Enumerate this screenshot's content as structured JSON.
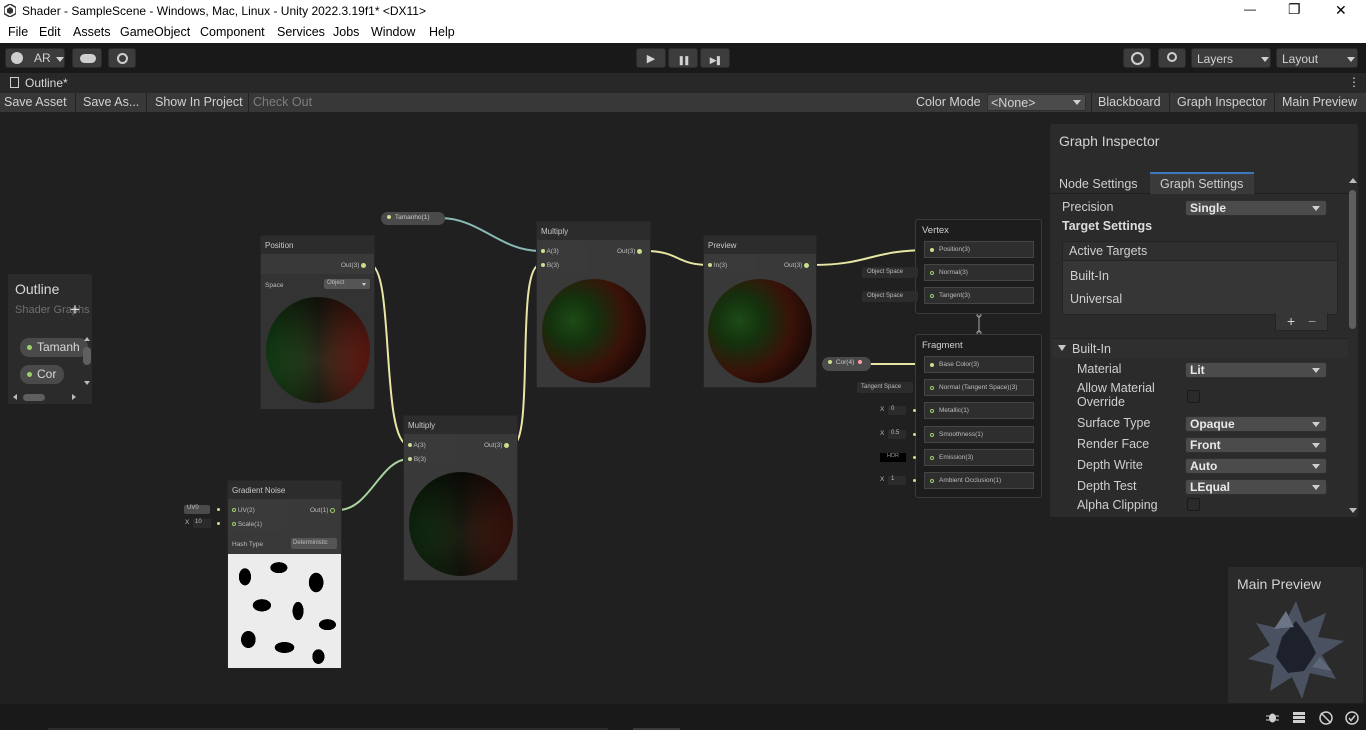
{
  "window": {
    "title": "Shader - SampleScene - Windows, Mac, Linux - Unity 2022.3.19f1* <DX11>",
    "minimize": "—",
    "restore": "❐",
    "close": "✕"
  },
  "menu": [
    "File",
    "Edit",
    "Assets",
    "GameObject",
    "Component",
    "Services",
    "Jobs",
    "Window",
    "Help"
  ],
  "toolbar": {
    "account_label": "AR",
    "play": "▶",
    "pause": "❚❚",
    "step": "▶❚",
    "layers_label": "Layers",
    "layout_label": "Layout"
  },
  "tab": {
    "label": "Outline*",
    "more": "⋮"
  },
  "graph_toolbar": {
    "save_asset": "Save Asset",
    "save_as": "Save As...",
    "show_in_project": "Show In Project",
    "check_out": "Check Out",
    "color_mode_label": "Color Mode",
    "color_mode_value": "<None>",
    "blackboard": "Blackboard",
    "graph_inspector": "Graph Inspector",
    "main_preview": "Main Preview"
  },
  "blackboard": {
    "title": "Outline",
    "subtitle": "Shader Graphs",
    "add": "+",
    "properties": [
      "Tamanh",
      "Cor"
    ]
  },
  "nodes": {
    "position": {
      "title": "Position",
      "out": "Out(3)",
      "space_label": "Space",
      "space_value": "Object"
    },
    "tamanho_pill": "Tamanho(1)",
    "multiply1": {
      "title": "Multiply",
      "a": "A(3)",
      "b": "B(3)",
      "out": "Out(3)"
    },
    "preview": {
      "title": "Preview",
      "in": "In(3)",
      "out": "Out(3)"
    },
    "multiply2": {
      "title": "Multiply",
      "a": "A(3)",
      "b": "B(3)",
      "out": "Out(3)"
    },
    "gradient_noise": {
      "title": "Gradient Noise",
      "uv": "UV(2)",
      "scale": "Scale(1)",
      "out": "Out(1)",
      "hash_label": "Hash Type",
      "hash_value": "Deterministic",
      "uv_ctx": "UV0",
      "scale_ctx_x": "X",
      "scale_ctx_val": "10"
    },
    "vertex": {
      "title": "Vertex",
      "position": "Position(3)",
      "normal": "Normal(3)",
      "tangent": "Tangent(3)",
      "normal_ctx": "Object Space",
      "tangent_ctx": "Object Space"
    },
    "fragment": {
      "title": "Fragment",
      "base_color": "Base Color(3)",
      "normal": "Normal (Tangent Space)(3)",
      "metallic": "Metallic(1)",
      "smoothness": "Smoothness(1)",
      "emission": "Emission(3)",
      "ao": "Ambient Occlusion(1)",
      "normal_ctx": "Tangent Space",
      "metallic_ctx_x": "X",
      "metallic_ctx_val": "0",
      "smoothness_ctx_x": "X",
      "smoothness_ctx_val": "0.5",
      "emission_ctx": "HDR",
      "ao_ctx_x": "X",
      "ao_ctx_val": "1"
    },
    "cor_pill": "Cor(4)"
  },
  "inspector": {
    "title": "Graph Inspector",
    "tab_node": "Node Settings",
    "tab_graph": "Graph Settings",
    "precision_label": "Precision",
    "precision_value": "Single",
    "target_settings": "Target Settings",
    "active_targets": "Active Targets",
    "targets": [
      "Built-In",
      "Universal"
    ],
    "add": "+",
    "remove": "−",
    "builtin_header": "Built-In",
    "material_label": "Material",
    "material_value": "Lit",
    "allow_override_label1": "Allow Material",
    "allow_override_label2": "Override",
    "surface_type_label": "Surface Type",
    "surface_type_value": "Opaque",
    "render_face_label": "Render Face",
    "render_face_value": "Front",
    "depth_write_label": "Depth Write",
    "depth_write_value": "Auto",
    "depth_test_label": "Depth Test",
    "depth_test_value": "LEqual",
    "alpha_clipping_label": "Alpha Clipping"
  },
  "main_preview": {
    "title": "Main Preview"
  }
}
